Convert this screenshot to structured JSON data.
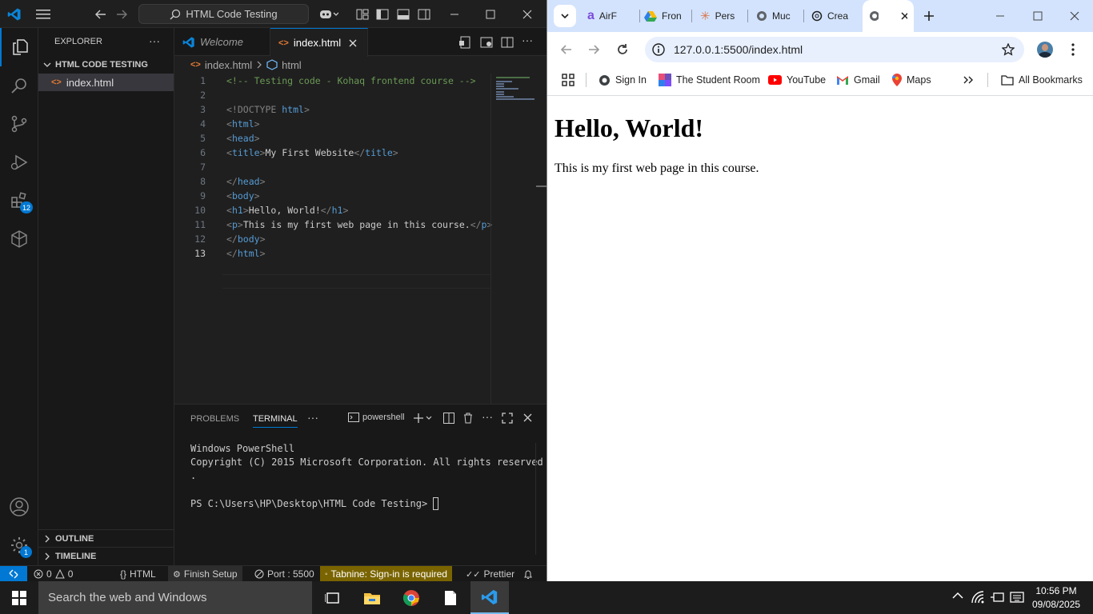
{
  "vscode": {
    "search_label": "HTML Code Testing",
    "explorer": {
      "title": "EXPLORER",
      "folder": "HTML CODE TESTING",
      "files": [
        "index.html"
      ],
      "outline": "OUTLINE",
      "timeline": "TIMELINE"
    },
    "extensions_badge": "12",
    "accounts_badge": "1",
    "tabs": [
      {
        "label": "Welcome",
        "active": false
      },
      {
        "label": "index.html",
        "active": true
      }
    ],
    "breadcrumb": [
      "index.html",
      "html"
    ],
    "code_lines": [
      "<!-- Testing code - Kohaq frontend course -->",
      "",
      "<!DOCTYPE html>",
      "<html>",
      "<head>",
      "<title>My First Website</title>",
      "",
      "</head>",
      "<body>",
      "<h1>Hello, World!</h1>",
      "<p>This is my first web page in this course.</p>",
      "</body>",
      "</html>"
    ],
    "line_numbers": [
      "1",
      "2",
      "3",
      "4",
      "5",
      "6",
      "7",
      "8",
      "9",
      "10",
      "11",
      "12",
      "13"
    ],
    "current_line": "13",
    "panel": {
      "tabs": [
        "PROBLEMS",
        "TERMINAL"
      ],
      "active_tab": "TERMINAL",
      "shell": "powershell",
      "lines": [
        "Windows PowerShell",
        "Copyright (C) 2015 Microsoft Corporation. All rights reserved",
        ".",
        "",
        "PS C:\\Users\\HP\\Desktop\\HTML Code Testing> "
      ]
    },
    "status": {
      "errors": "0",
      "warnings": "0",
      "language": "HTML",
      "finish_setup": "Finish Setup",
      "port": "Port : 5500",
      "tabnine": "Tabnine: Sign-in is required",
      "prettier": "Prettier"
    },
    "colors": {
      "accent": "#0078d4",
      "tabnine_bg": "#7a6400"
    }
  },
  "chrome": {
    "tabs": [
      {
        "label": "AirF",
        "icon": "airfocus-icon"
      },
      {
        "label": "Fron",
        "icon": "drive-icon"
      },
      {
        "label": "Pers",
        "icon": "claude-icon"
      },
      {
        "label": "Muc",
        "icon": "globe-icon"
      },
      {
        "label": "Crea",
        "icon": "chatgpt-icon"
      },
      {
        "label": "",
        "icon": "globe-icon",
        "active": true
      }
    ],
    "url": "127.0.0.1:5500/index.html",
    "bookmarks": [
      "Sign In",
      "The Student Room",
      "YouTube",
      "Gmail",
      "Maps"
    ],
    "all_bookmarks": "All Bookmarks",
    "page": {
      "heading": "Hello, World!",
      "paragraph": "This is my first web page in this course."
    }
  },
  "taskbar": {
    "search_placeholder": "Search the web and Windows",
    "time": "10:56 PM",
    "date": "09/08/2025"
  }
}
